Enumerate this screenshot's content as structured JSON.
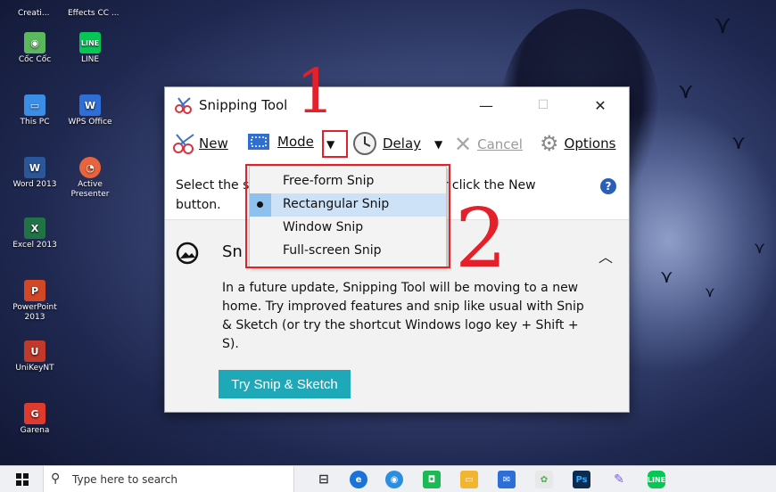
{
  "desktop": {
    "top_labels": [
      "Creati...",
      "Effects CC ..."
    ],
    "icons": [
      {
        "label": "Cốc Cốc",
        "glyph": "◉",
        "color": "#5cb85c"
      },
      {
        "label": "LINE",
        "glyph": "LINE",
        "color": "#06c755"
      },
      {
        "label": "This PC",
        "glyph": "▭",
        "color": "#3a8ee6"
      },
      {
        "label": "WPS Office",
        "glyph": "W",
        "color": "#2d6fd6"
      },
      {
        "label": "Word 2013",
        "glyph": "W",
        "color": "#2b579a"
      },
      {
        "label": "Active Presenter",
        "glyph": "◔",
        "color": "#e8643c"
      },
      {
        "label": "Excel 2013",
        "glyph": "X",
        "color": "#217346"
      },
      {
        "label": "PowerPoint 2013",
        "glyph": "P",
        "color": "#d24726"
      },
      {
        "label": "UniKeyNT",
        "glyph": "U",
        "color": "#c0392b"
      },
      {
        "label": "Garena",
        "glyph": "G",
        "color": "#e03a2f"
      }
    ]
  },
  "window": {
    "title": "Snipping Tool",
    "minimize_glyph": "—",
    "maximize_glyph": "☐",
    "close_glyph": "✕",
    "toolbar": {
      "new_label": "New",
      "mode_label": "Mode",
      "delay_label": "Delay",
      "cancel_label": "Cancel",
      "options_label": "Options"
    },
    "notice_start": "Select the s",
    "notice_end": "on or click the New",
    "notice_line2": "button.",
    "panel": {
      "heading": "Sn",
      "body": "In a future update, Snipping Tool will be moving to a new home. Try improved features and snip like usual with Snip & Sketch (or try the shortcut Windows logo key + Shift + S).",
      "button_label": "Try Snip & Sketch"
    }
  },
  "mode_menu": {
    "items": [
      {
        "label": "Free-form Snip",
        "selected": false
      },
      {
        "label": "Rectangular Snip",
        "selected": true
      },
      {
        "label": "Window Snip",
        "selected": false
      },
      {
        "label": "Full-screen Snip",
        "selected": false
      }
    ]
  },
  "annotations": {
    "step1": "1",
    "step2": "2",
    "color": "#e4202a"
  },
  "taskbar": {
    "search_placeholder": "Type here to search"
  }
}
